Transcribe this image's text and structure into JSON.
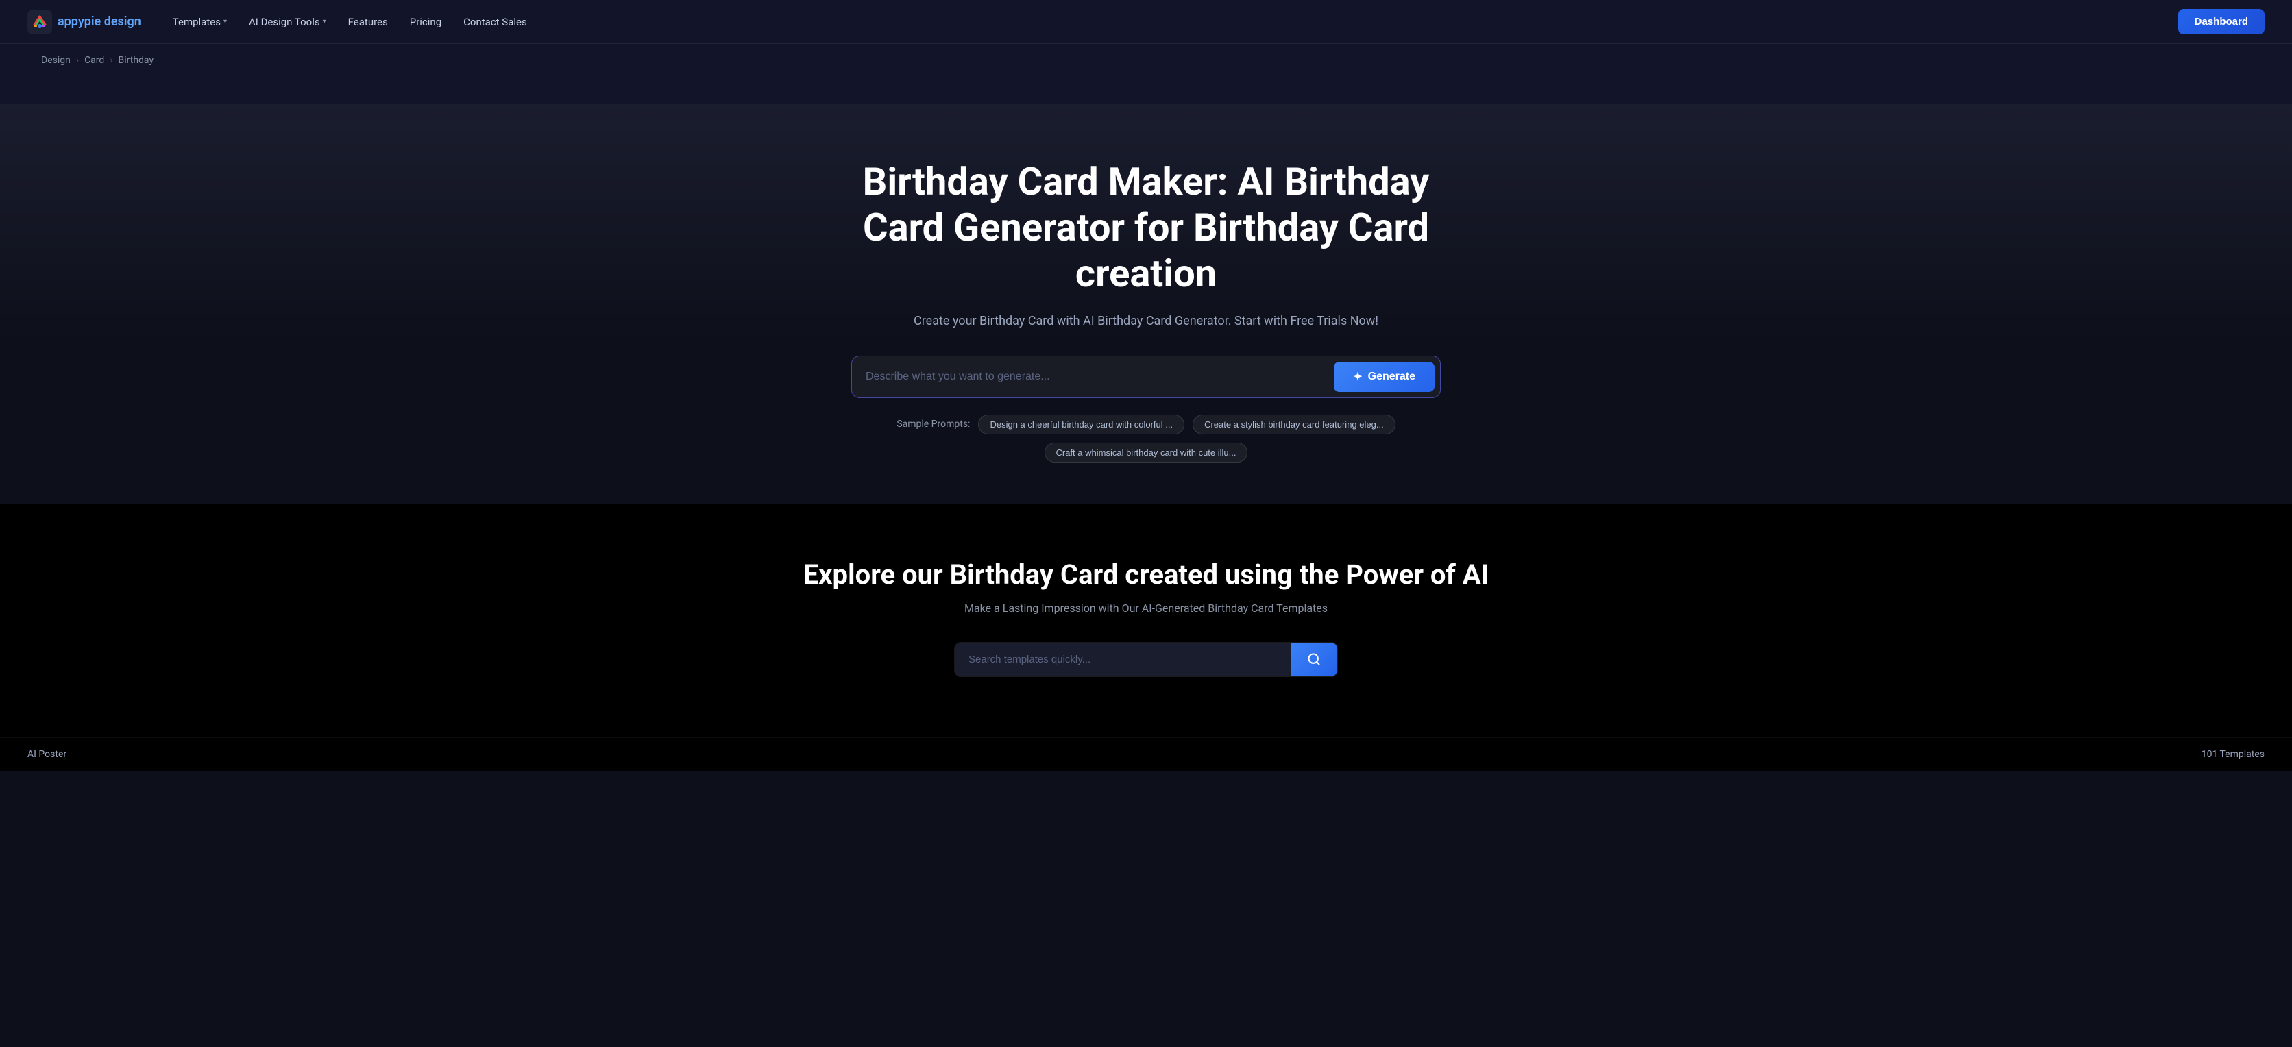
{
  "brand": {
    "name_part1": "appypie",
    "name_part2": "design"
  },
  "nav": {
    "links": [
      {
        "id": "templates",
        "label": "Templates",
        "hasDropdown": true
      },
      {
        "id": "ai-design-tools",
        "label": "AI Design Tools",
        "hasDropdown": true
      },
      {
        "id": "features",
        "label": "Features",
        "hasDropdown": false
      },
      {
        "id": "pricing",
        "label": "Pricing",
        "hasDropdown": false
      },
      {
        "id": "contact-sales",
        "label": "Contact Sales",
        "hasDropdown": false
      }
    ],
    "cta": "Dashboard"
  },
  "breadcrumb": {
    "items": [
      {
        "label": "Design",
        "href": "#"
      },
      {
        "label": "Card",
        "href": "#"
      },
      {
        "label": "Birthday",
        "href": "#"
      }
    ]
  },
  "hero": {
    "title": "Birthday Card Maker: AI Birthday Card Generator for Birthday Card creation",
    "subtitle": "Create your Birthday Card with AI Birthday Card Generator. Start with Free Trials Now!",
    "input_placeholder": "Describe what you want to generate...",
    "generate_button": "Generate",
    "sample_prompts_label": "Sample Prompts:",
    "prompts": [
      {
        "id": "prompt1",
        "text": "Design a cheerful birthday card with colorful ..."
      },
      {
        "id": "prompt2",
        "text": "Create a stylish birthday card featuring eleg..."
      },
      {
        "id": "prompt3",
        "text": "Craft a whimsical birthday card with cute illu..."
      }
    ]
  },
  "explore": {
    "title": "Explore our Birthday Card created using the Power of AI",
    "subtitle": "Make a Lasting Impression with Our AI-Generated Birthday Card Templates",
    "search_placeholder": "Search templates quickly..."
  },
  "bottom_bar": {
    "ai_poster_label": "AI Poster",
    "templates_count": "101 Templates"
  },
  "colors": {
    "accent": "#2563eb",
    "accent_hover": "#3b82f6",
    "bg_dark": "#0d0f1a",
    "bg_card": "#12152a",
    "text_muted": "#8892a4"
  }
}
